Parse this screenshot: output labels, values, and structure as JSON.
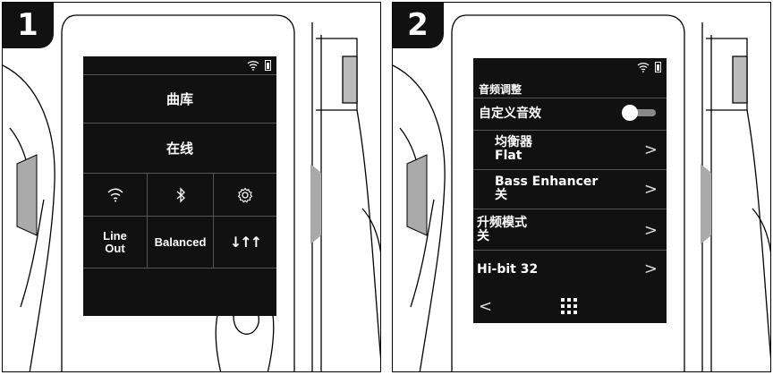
{
  "steps": {
    "one": "1",
    "two": "2"
  },
  "screen1": {
    "menu": {
      "library": "曲库",
      "online": "在线"
    },
    "grid": {
      "wifi_icon": "wifi-icon",
      "bluetooth_icon": "bluetooth-icon",
      "settings_icon": "gear-icon",
      "line_out_1": "Line",
      "line_out_2": "Out",
      "balanced": "Balanced",
      "eq_icon": "sound-adjust-icon",
      "eq_glyph": "↓↑↑"
    }
  },
  "screen2": {
    "title": "音频调整",
    "custom": "自定义音效",
    "eq_label": "均衡器",
    "eq_value": "Flat",
    "bass_label": "Bass Enhancer",
    "bass_value": "关",
    "upsample_label": "升频模式",
    "upsample_value": "关",
    "hibit": "Hi-bit 32",
    "chevron": ">",
    "back": "<"
  },
  "colors": {
    "screen": "#111111",
    "divider": "#555555",
    "badge": "#111111"
  }
}
